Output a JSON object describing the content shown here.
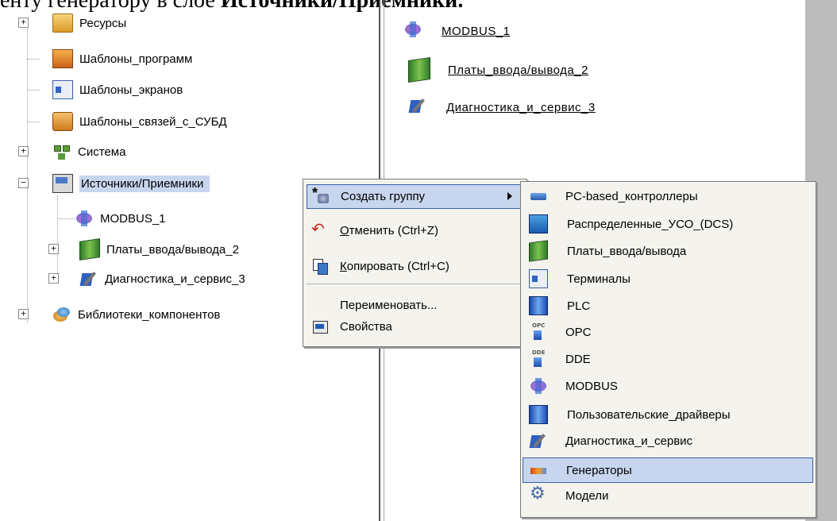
{
  "heading": {
    "left_text": "енту генератору в слое ",
    "bold_text": "Источники/Приемники."
  },
  "tree": {
    "items": [
      {
        "label": "Ресурсы",
        "expander": "+",
        "icon": "folder-icon"
      },
      {
        "label": "Шаблоны_программ",
        "icon": "program-templates-icon"
      },
      {
        "label": "Шаблоны_экранов",
        "icon": "screen-templates-icon"
      },
      {
        "label": "Шаблоны_связей_с_СУБД",
        "icon": "db-link-templates-icon"
      },
      {
        "label": "Система",
        "expander": "+",
        "icon": "system-network-icon"
      },
      {
        "label": "Источники/Приемники",
        "expander": "−",
        "icon": "sources-receivers-icon",
        "selected": true
      },
      {
        "label": "MODBUS_1",
        "icon": "modbus-icon"
      },
      {
        "label": "Платы_ввода/вывода_2",
        "expander": "+",
        "icon": "io-board-icon"
      },
      {
        "label": "Диагностика_и_сервис_3",
        "expander": "+",
        "icon": "diagnostics-icon"
      },
      {
        "label": "Библиотеки_компонентов",
        "expander": "+",
        "icon": "component-library-icon"
      }
    ]
  },
  "right_pane": {
    "items": [
      {
        "label": "MODBUS_1",
        "icon": "modbus-icon"
      },
      {
        "label": "Платы_ввода/вывода_2",
        "icon": "io-board-icon"
      },
      {
        "label": "Диагностика_и_сервис_3",
        "icon": "diagnostics-icon"
      }
    ]
  },
  "context_menu": {
    "create_group": "Создать группу",
    "undo_u": "О",
    "undo_rest": "тменить (Ctrl+Z)",
    "copy_u": "К",
    "copy_rest": "опировать (Ctrl+C)",
    "rename": "Переименовать...",
    "properties": "Свойства"
  },
  "submenu": {
    "items": [
      {
        "label": "PC-based_контроллеры",
        "icon": "pc-based-controller-icon"
      },
      {
        "label": "Распределенные_УСО_(DCS)",
        "icon": "dcs-icon"
      },
      {
        "label": "Платы_ввода/вывода",
        "icon": "io-board-icon"
      },
      {
        "label": "Терминалы",
        "icon": "terminal-icon"
      },
      {
        "label": "PLC",
        "icon": "plc-icon"
      },
      {
        "label": "OPC",
        "icon": "opc-icon"
      },
      {
        "label": "DDE",
        "icon": "dde-icon"
      },
      {
        "label": "MODBUS",
        "icon": "modbus-icon"
      },
      {
        "label": "Пользовательские_драйверы",
        "icon": "user-driver-icon"
      },
      {
        "label": "Диагностика_и_сервис",
        "icon": "diagnostics-icon"
      },
      {
        "label": "Генераторы",
        "icon": "generator-icon",
        "highlighted": true
      },
      {
        "label": "Модели",
        "icon": "models-icon"
      }
    ]
  },
  "colors": {
    "selection": "#c7d6ee",
    "menu_bg": "#f4f3ee",
    "highlight_border": "#3a5faa",
    "right_strip": "#bcbcbc"
  }
}
